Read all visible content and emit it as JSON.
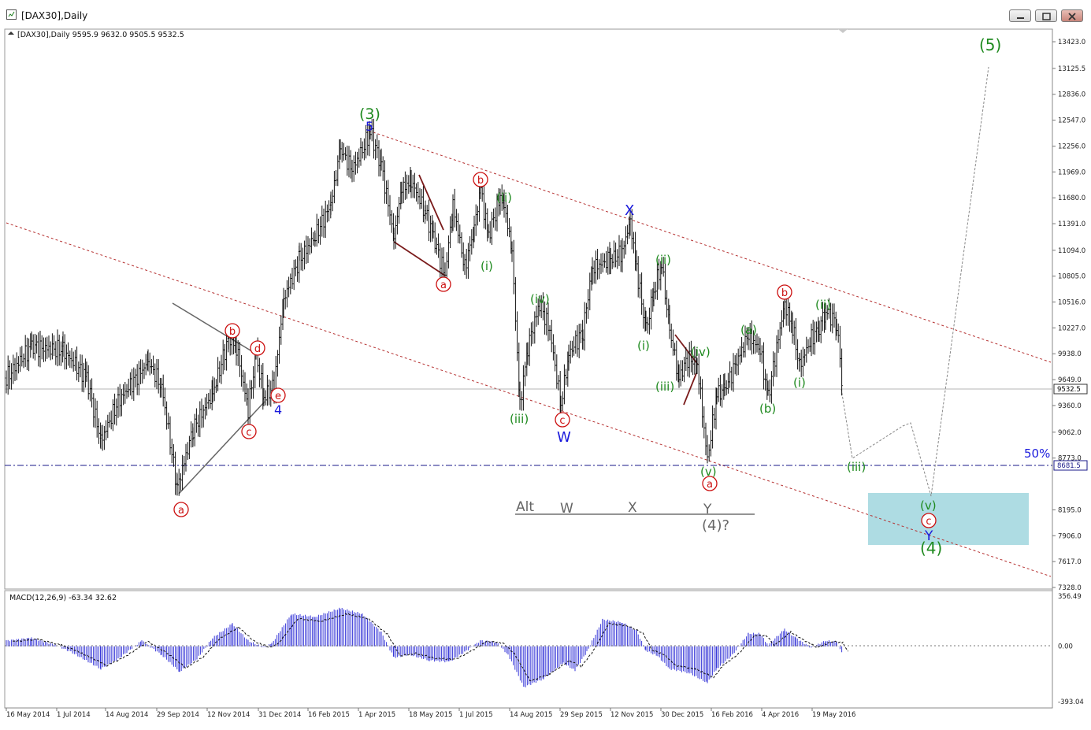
{
  "window": {
    "title": "[DAX30],Daily",
    "buttons": [
      "minimize",
      "restore",
      "close"
    ]
  },
  "chart_header": "[DAX30],Daily  9595.9 9632.0 9505.5 9532.5",
  "price_labels": [
    "13423.0",
    "13125.5",
    "12836.0",
    "12547.0",
    "12256.0",
    "11969.0",
    "11680.0",
    "11391.0",
    "11094.0",
    "10805.0",
    "10516.0",
    "10227.0",
    "9938.0",
    "9649.0",
    "9360.0",
    "9062.0",
    "8773.0",
    "8195.0",
    "7906.0",
    "7617.0",
    "7328.0"
  ],
  "current_price_label": "9532.5",
  "line_price_label": "8681.5",
  "macd_header": "MACD(12,26,9) -63.34 32.62",
  "macd_labels": [
    "356.49",
    "0.00",
    "-393.04"
  ],
  "date_labels": [
    "16 May 2014",
    "1 Jul 2014",
    "14 Aug 2014",
    "29 Sep 2014",
    "12 Nov 2014",
    "31 Dec 2014",
    "16 Feb 2015",
    "1 Apr 2015",
    "18 May 2015",
    "1 Jul 2015",
    "14 Aug 2015",
    "29 Sep 2015",
    "12 Nov 2015",
    "30 Dec 2015",
    "16 Feb 2016",
    "4 Apr 2016",
    "19 May 2016"
  ],
  "annotations": {
    "wave3": "(3)",
    "wave5": "(5)",
    "wave4": "(4)",
    "five": "5",
    "four": "4",
    "pct50": "50%",
    "W": "W",
    "X": "X",
    "Y": "Y",
    "alt": "Alt",
    "altW": "W",
    "altX": "X",
    "altY": "Y",
    "alt4": "(4)?",
    "i": "(i)",
    "ii": "(ii)",
    "iii": "(iii)",
    "iv": "(iv)",
    "v": "(v)",
    "a": "(a)",
    "b": "(b)",
    "circ_a": "a",
    "circ_b": "b",
    "circ_c": "c",
    "circ_d": "d",
    "circ_e": "e"
  },
  "colors": {
    "green": "#1f8a1f",
    "red": "#cc1111",
    "blue": "#1a1adc",
    "macd": "#3a3ad8",
    "channel": "#b53030",
    "target_box": "#aedce3",
    "grey": "#666666"
  },
  "chart_data": {
    "type": "ohlc",
    "title": "[DAX30],Daily",
    "series": [
      {
        "name": "DAX30 Daily",
        "x": [
          "16 May 2014",
          "1 Jul 2014",
          "14 Aug 2014",
          "29 Sep 2014",
          "12 Nov 2014",
          "31 Dec 2014",
          "16 Feb 2015",
          "1 Apr 2015",
          "18 May 2015",
          "1 Jul 2015",
          "14 Aug 2015",
          "29 Sep 2015",
          "12 Nov 2015",
          "30 Dec 2015",
          "16 Feb 2016",
          "4 Apr 2016",
          "19 May 2016"
        ],
        "close": [
          9700,
          9900,
          9200,
          8900,
          9650,
          9800,
          11050,
          12300,
          11600,
          11200,
          10900,
          9600,
          10950,
          10700,
          9200,
          10000,
          10150
        ]
      },
      {
        "name": "MACD(12,26,9)",
        "x": [
          "16 May 2014",
          "1 Jul 2014",
          "14 Aug 2014",
          "29 Sep 2014",
          "12 Nov 2014",
          "31 Dec 2014",
          "16 Feb 2015",
          "1 Apr 2015",
          "18 May 2015",
          "1 Jul 2015",
          "14 Aug 2015",
          "29 Sep 2015",
          "12 Nov 2015",
          "30 Dec 2015",
          "16 Feb 2016",
          "4 Apr 2016",
          "19 May 2016"
        ],
        "values": [
          90,
          -20,
          -140,
          -300,
          120,
          70,
          320,
          260,
          -80,
          5,
          -370,
          -180,
          210,
          -120,
          -300,
          110,
          25
        ]
      }
    ],
    "last": {
      "open": 9595.9,
      "high": 9632.0,
      "low": 9505.5,
      "close": 9532.5
    },
    "macd_last": {
      "macd": -63.34,
      "signal": 32.62
    },
    "horizontal_level": 8681.5,
    "ylim": [
      7328,
      13423
    ],
    "macd_ylim": [
      -393.04,
      356.49
    ]
  }
}
